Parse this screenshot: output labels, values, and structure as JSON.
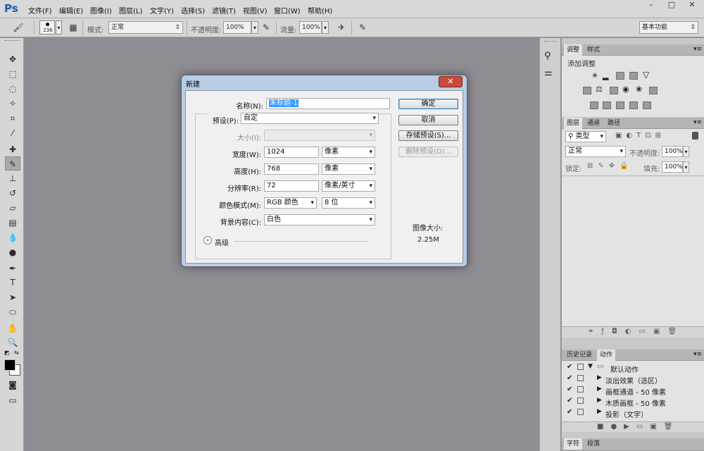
{
  "app": {
    "logo": "Ps",
    "menu": [
      "文件(F)",
      "编辑(E)",
      "图像(I)",
      "图层(L)",
      "文字(Y)",
      "选择(S)",
      "滤镜(T)",
      "视图(V)",
      "窗口(W)",
      "帮助(H)"
    ],
    "window_buttons": [
      "–",
      "□",
      "✕"
    ]
  },
  "options_bar": {
    "brush_size": "236",
    "mode_label": "模式:",
    "mode_value": "正常",
    "opacity_label": "不透明度:",
    "opacity_value": "100%",
    "flow_label": "流量:",
    "flow_value": "100%",
    "workspace": "基本功能"
  },
  "dialog": {
    "title": "新建",
    "close_label": "✕",
    "name_label": "名称(N):",
    "name_value": "未标题-1",
    "preset_label": "预设(P):",
    "preset_value": "自定",
    "size_label": "大小(I):",
    "size_value": "",
    "width_label": "宽度(W):",
    "width_value": "1024",
    "width_unit": "像素",
    "height_label": "高度(H):",
    "height_value": "768",
    "height_unit": "像素",
    "resolution_label": "分辨率(R):",
    "resolution_value": "72",
    "resolution_unit": "像素/英寸",
    "color_mode_label": "颜色模式(M):",
    "color_mode_value": "RGB 颜色",
    "bit_depth": "8 位",
    "background_label": "背景内容(C):",
    "background_value": "白色",
    "advanced_label": "高级",
    "ok_button": "确定",
    "cancel_button": "取消",
    "save_preset_button": "存储预设(S)...",
    "delete_preset_button": "删除预设(D)...",
    "image_size_label": "图像大小:",
    "image_size_value": "2.25M"
  },
  "adjustments_panel": {
    "tabs": [
      "调整",
      "样式"
    ],
    "title": "添加调整"
  },
  "layers_panel": {
    "tabs": [
      "图层",
      "通道",
      "路径"
    ],
    "kind_filter": "类型",
    "blend_mode": "正常",
    "opacity_label": "不透明度:",
    "opacity_value": "100%",
    "lock_label": "锁定:",
    "fill_label": "填充:",
    "fill_value": "100%"
  },
  "history_panel": {
    "tabs": [
      "历史记录",
      "动作"
    ],
    "actions": [
      "默认动作",
      "淡出效果（选区）",
      "画框通道 - 50 像素",
      "木质画框 - 50 像素",
      "投影（文字）"
    ]
  },
  "bottom_panel": {
    "tabs": [
      "字符",
      "段落"
    ]
  }
}
